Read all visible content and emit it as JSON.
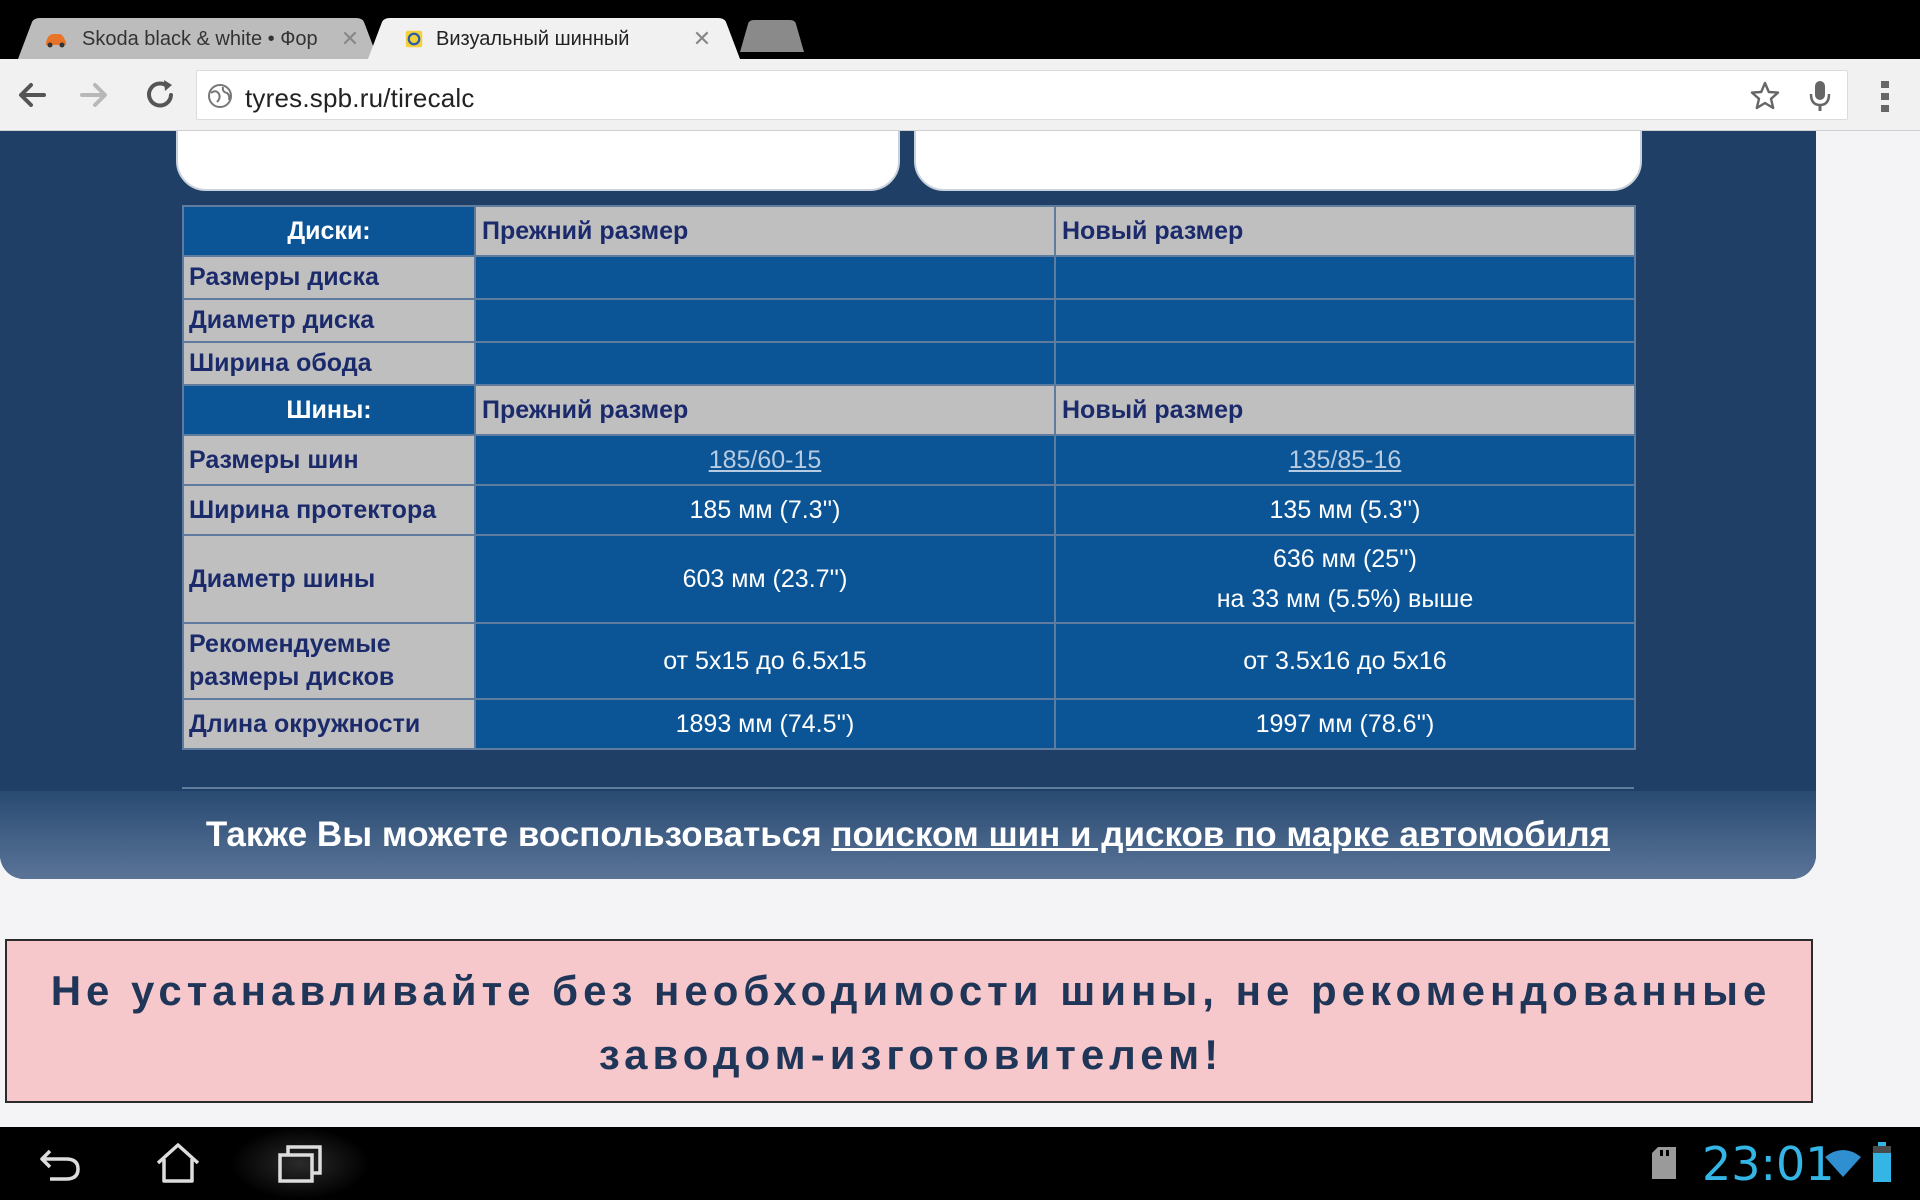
{
  "tabs": [
    {
      "title": "Skoda black & white • Фор",
      "active": false
    },
    {
      "title": "Визуальный шинный",
      "active": true
    }
  ],
  "address_bar": {
    "url": "tyres.spb.ru/tirecalc"
  },
  "table": {
    "discs_header": "Диски:",
    "old_size": "Прежний размер",
    "new_size": "Новый размер",
    "disc_rows": [
      {
        "label": "Размеры диска",
        "old": "",
        "new": ""
      },
      {
        "label": "Диаметр диска",
        "old": "",
        "new": ""
      },
      {
        "label": "Ширина обода",
        "old": "",
        "new": ""
      }
    ],
    "tires_header": "Шины:",
    "tire_sizes": {
      "label": "Размеры шин",
      "old": "185/60-15",
      "new": "135/85-16"
    },
    "tread_width": {
      "label": "Ширина протектора",
      "old": "185 мм (7.3'')",
      "new": "135 мм (5.3'')"
    },
    "tire_diameter": {
      "label": "Диаметр шины",
      "old": "603 мм (23.7'')",
      "new_line1": "636 мм (25'')",
      "new_line2": "на 33 мм (5.5%) выше"
    },
    "recommended": {
      "label_line1": "Рекомендуемые",
      "label_line2": "размеры дисков",
      "old": "от 5x15 до 6.5x15",
      "new": "от 3.5x16 до 5x16"
    },
    "circumference": {
      "label": "Длина окружности",
      "old": "1893 мм (74.5'')",
      "new": "1997 мм (78.6'')"
    }
  },
  "footer": {
    "text": "Также Вы можете воспользоваться ",
    "link": "поиском шин и дисков по марке автомобиля"
  },
  "warning": {
    "line1": "Не устанавливайте без необходимости шины, не рекомендованные",
    "line2": "заводом-изготовителем!"
  },
  "status_bar": {
    "time": "23:01"
  },
  "colors": {
    "table_blue": "#0b5596",
    "panel_navy": "#1f3f66",
    "label_gray": "#bfbfbf",
    "clock_blue": "#33b5e5",
    "warning_pink": "#f7c8cb"
  }
}
